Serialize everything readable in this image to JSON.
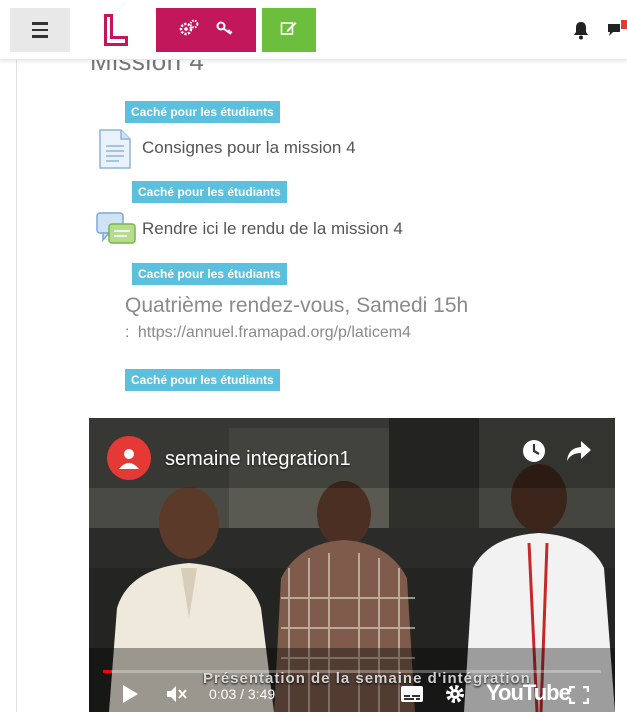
{
  "header": {
    "menu_icon": "hamburger-icon",
    "logo_icon": "logo-icon",
    "admin_icons": [
      "cogs-icon",
      "key-icon"
    ],
    "edit_icon": "edit-icon",
    "notifications_icon": "bell-icon",
    "messages_icon": "chat-icon",
    "colors": {
      "pink": "#c2185b",
      "green": "#6cbf3c"
    }
  },
  "section": {
    "title": "Mission 4"
  },
  "badges": {
    "hidden": "Caché pour les étudiants"
  },
  "activities": [
    {
      "label": "Consignes pour la mission 4",
      "icon": "document-icon"
    },
    {
      "label": "Rendre ici le rendu de la mission 4",
      "icon": "forum-icon"
    }
  ],
  "rdv": {
    "title": "Quatrième rendez-vous, Samedi 15h",
    "link_prefix": ":",
    "link": "https://annuel.framapad.org/p/laticem4"
  },
  "video": {
    "channel_icon": "avatar-icon",
    "title": "semaine integration1",
    "watch_later_icon": "clock-icon",
    "share_icon": "share-icon",
    "subtitle": "Présentation de la semaine d'intégration",
    "time": "0:03 / 3:49",
    "progress": 0.013,
    "brand": "YouTube",
    "play_icon": "play-icon",
    "mute_icon": "mute-icon",
    "captions_icon": "captions-icon",
    "settings_icon": "gear-icon",
    "fullscreen_icon": "fullscreen-icon"
  }
}
